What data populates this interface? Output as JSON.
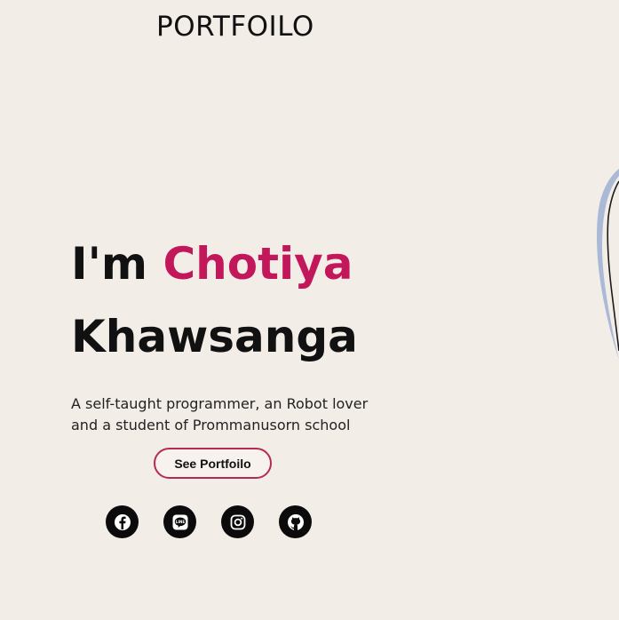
{
  "header": {
    "brand": "PORTFOILO"
  },
  "hero": {
    "greeting": "I'm",
    "first_name": "Chotiya",
    "last_name": "Khawsanga",
    "tagline_line1": "A self-taught programmer, an Robot lover",
    "tagline_line2": "and a student of Prommanusorn school",
    "cta_label": "See Portfoilo"
  },
  "socials": [
    {
      "icon": "facebook-icon"
    },
    {
      "icon": "line-icon"
    },
    {
      "icon": "instagram-icon"
    },
    {
      "icon": "github-icon"
    }
  ],
  "colors": {
    "background": "#f3ede8",
    "accent": "#c2185b",
    "button_border": "#b52a55",
    "text": "#111111",
    "decor_blue": "#a9b9d6"
  }
}
